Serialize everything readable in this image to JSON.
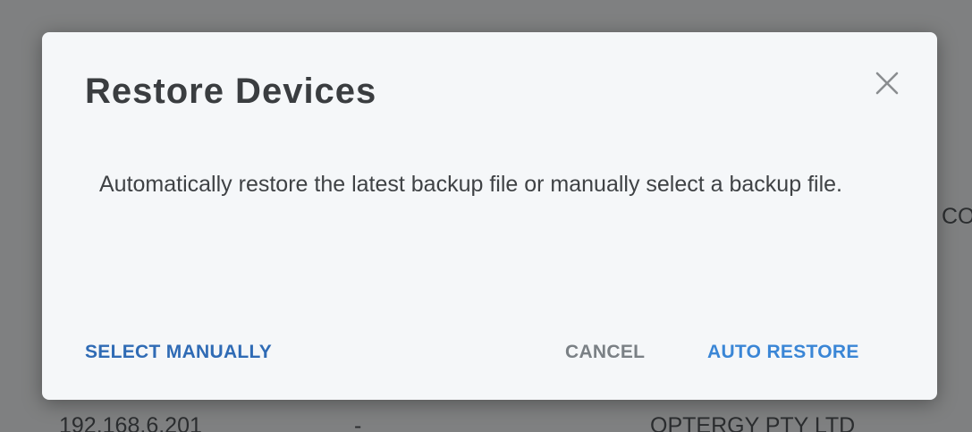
{
  "background": {
    "row": {
      "ip": "192.168.6.201",
      "dash": "-",
      "company": "OPTERGY PTY LTD"
    },
    "partial_text": "CO."
  },
  "dialog": {
    "title": "Restore Devices",
    "message": "Automatically restore the latest backup file or manually select a backup file.",
    "close_icon": "close-icon",
    "buttons": {
      "select_manually": "SELECT MANUALLY",
      "cancel": "CANCEL",
      "auto_restore": "AUTO RESTORE"
    }
  },
  "colors": {
    "primary_button": "#2f6bb5",
    "accent_button": "#3a86d6",
    "cancel_button": "#7a8085",
    "dialog_bg": "#f5f7f9",
    "overlay": "#7f8081"
  }
}
